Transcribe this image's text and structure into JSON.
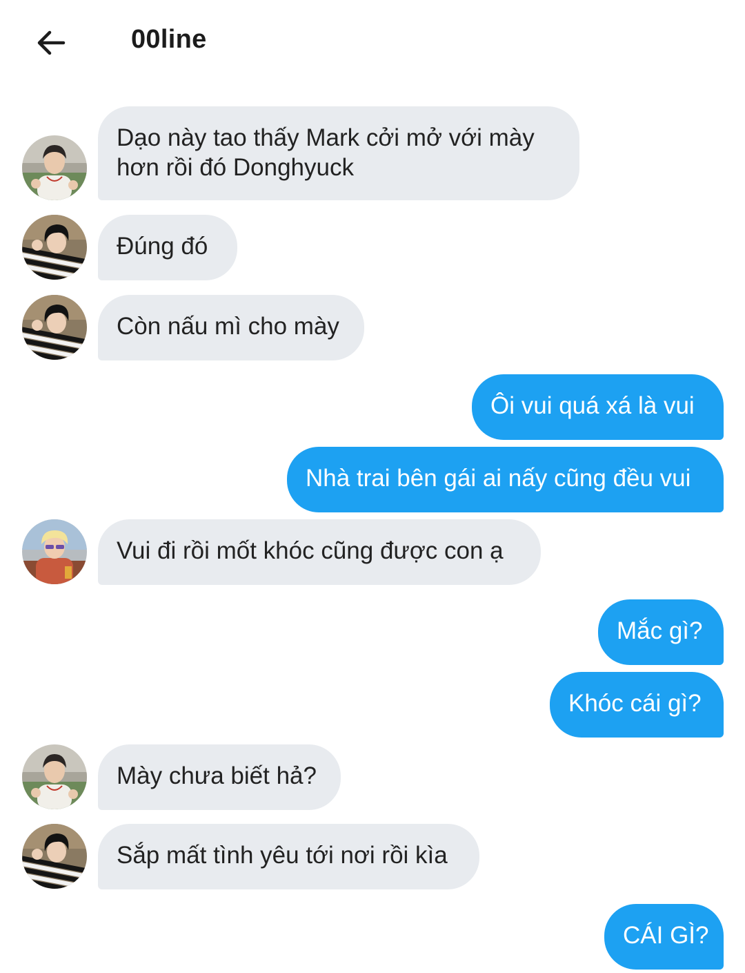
{
  "header": {
    "title": "00line",
    "back_icon": "arrow-left-icon"
  },
  "messages": [
    {
      "side": "in",
      "avatar": "avatar-a",
      "text": "Dạo này tao thấy Mark cởi mở với mày hơn rồi đó Donghyuck"
    },
    {
      "side": "in",
      "avatar": "avatar-b",
      "text": "Đúng đó"
    },
    {
      "side": "in",
      "avatar": "avatar-b",
      "text": "Còn nấu mì cho mày"
    },
    {
      "side": "out",
      "text": "Ôi vui quá xá là vui"
    },
    {
      "side": "out",
      "text": "Nhà trai bên gái ai nấy cũng đều vui"
    },
    {
      "side": "in",
      "avatar": "avatar-c",
      "text": "Vui đi rồi mốt khóc cũng được con ạ"
    },
    {
      "side": "out",
      "text": "Mắc gì?"
    },
    {
      "side": "out",
      "text": "Khóc cái gì?"
    },
    {
      "side": "in",
      "avatar": "avatar-a",
      "text": "Mày chưa biết hả?"
    },
    {
      "side": "in",
      "avatar": "avatar-b",
      "text": "Sắp mất tình yêu tới nơi rồi kìa"
    },
    {
      "side": "out",
      "text": "CÁI GÌ?"
    }
  ],
  "colors": {
    "incoming_bubble": "#e8ebef",
    "outgoing_bubble": "#1da1f2",
    "background": "#ffffff"
  }
}
